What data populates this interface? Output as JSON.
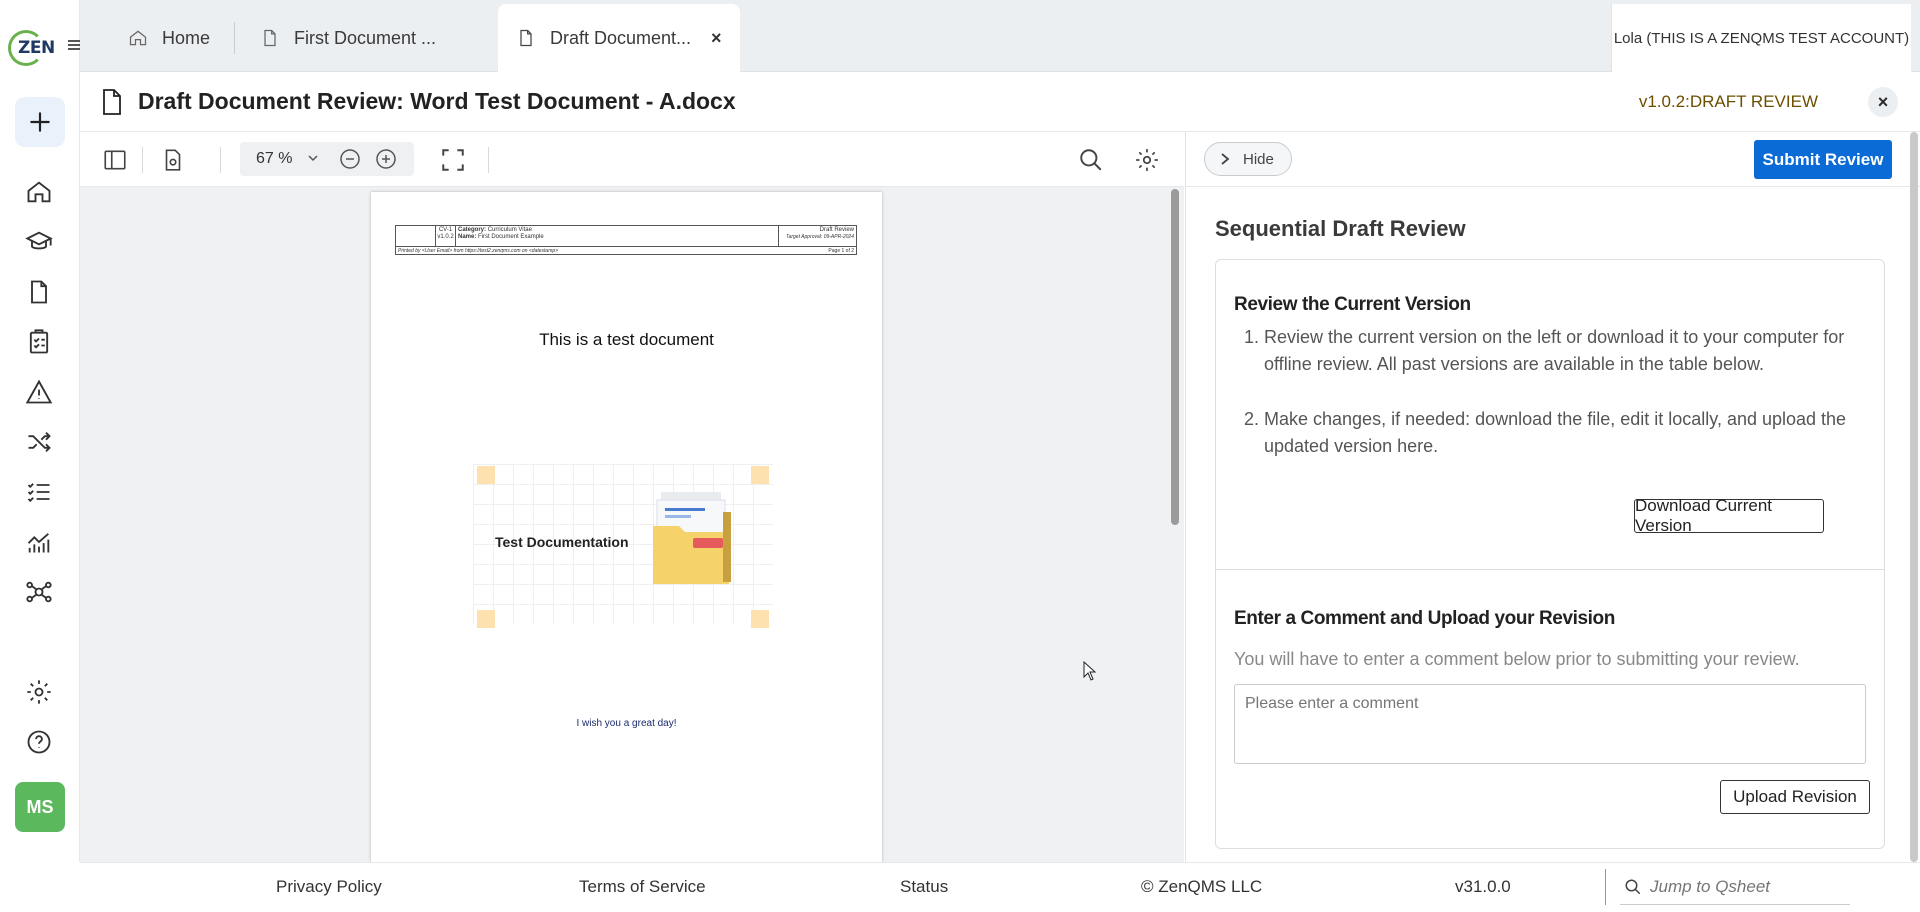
{
  "app": {
    "logo_text": "ZEN",
    "avatar_initials": "MS",
    "account_label": "Lola (THIS IS A ZENQMS TEST ACCOUNT)"
  },
  "tabs": [
    {
      "label": "Home"
    },
    {
      "label": "First Document ..."
    },
    {
      "label": "Draft Document..."
    }
  ],
  "header": {
    "title": "Draft Document Review: Word Test Document - A.docx",
    "version": "v1.0.2:DRAFT REVIEW"
  },
  "viewer": {
    "zoom": "67 %"
  },
  "document": {
    "hdr_id": "CV-1",
    "hdr_version": "v1.0.2",
    "hdr_category_label": "Category:",
    "hdr_category": "Curriculum Vitae",
    "hdr_name_label": "Name:",
    "hdr_name": "First Document Example",
    "hdr_status": "Draft Review",
    "hdr_target": "Target Approval: 09-APR-2024",
    "hdr_printed": "Printed by <User Email> from https://test2.zenqms.com on <datestamp>",
    "hdr_page": "Page 1 of 2",
    "title": "This is a test document",
    "illustration_label": "Test Documentation",
    "footer_text": "I wish you a great day!"
  },
  "panel": {
    "hide_label": "Hide",
    "submit_label": "Submit Review",
    "heading": "Sequential Draft Review",
    "section1_title": "Review the Current Version",
    "steps": [
      {
        "num": "1.",
        "text": "Review the current version on the left or download it to your computer for offline review. All past versions are available in the table below."
      },
      {
        "num": "2.",
        "text": "Make changes, if needed: download the file, edit it locally, and upload the updated version here."
      }
    ],
    "download_label": "Download Current Version",
    "section2_title": "Enter a Comment and Upload your Revision",
    "section2_desc": "You will have to enter a comment below prior to submitting your review.",
    "comment_placeholder": "Please enter a comment",
    "upload_label": "Upload Revision"
  },
  "footer": {
    "privacy": "Privacy Policy",
    "terms": "Terms of Service",
    "status": "Status",
    "copyright": "© ZenQMS LLC",
    "version": "v31.0.0",
    "jump_placeholder": "Jump to Qsheet"
  },
  "colors": {
    "primary": "#0a6ad6",
    "brand_green": "#6ab04c",
    "avatar_green": "#5cb85c",
    "version_text": "#6b4f00"
  }
}
